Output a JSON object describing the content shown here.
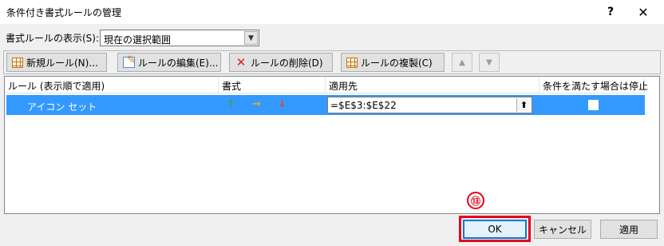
{
  "window": {
    "title": "条件付き書式ルールの管理",
    "help": "?",
    "close": "✕"
  },
  "show_rules": {
    "label": "書式ルールの表示(S):",
    "value": "現在の選択範囲"
  },
  "toolbar": {
    "new_rule": "新規ルール(N)...",
    "edit_rule": "ルールの編集(E)...",
    "delete_rule": "ルールの削除(D)",
    "duplicate_rule": "ルールの複製(C)",
    "move_up": "▲",
    "move_down": "▼"
  },
  "table": {
    "columns": [
      "ルール (表示順で適用)",
      "書式",
      "適用先",
      "条件を満たす場合は停止"
    ],
    "rows": [
      {
        "rule": "アイコン セット",
        "format_icons": [
          "↑",
          "→",
          "↓"
        ],
        "format_colors": [
          "#4f9a4f",
          "#f0a030",
          "#e04a28"
        ],
        "applies_to": "=$E$3:$E$22",
        "stop_if_true": false
      }
    ]
  },
  "annotation": {
    "marker": "⑬",
    "color": "#e8001a"
  },
  "buttons": {
    "ok": "OK",
    "cancel": "キャンセル",
    "apply": "適用"
  },
  "colors": {
    "selection": "#3399ff",
    "focus": "#0078d7"
  }
}
